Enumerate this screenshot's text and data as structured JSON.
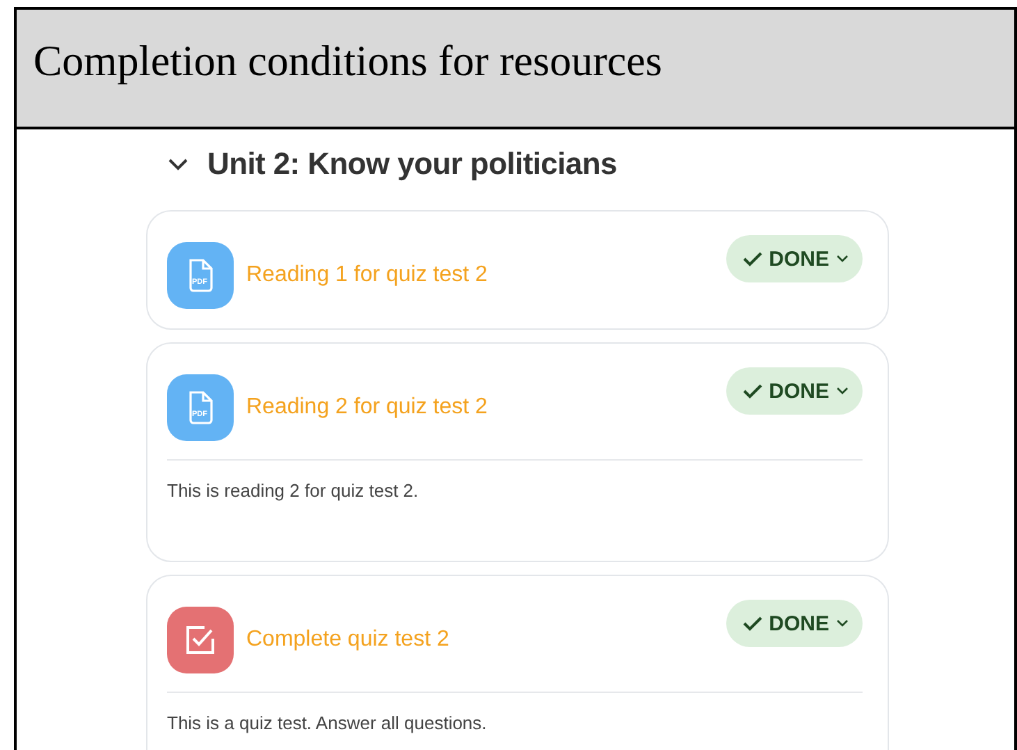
{
  "header": {
    "title": "Completion conditions for resources"
  },
  "section": {
    "title": "Unit 2: Know your politicians",
    "expanded": true,
    "activities": [
      {
        "kind": "pdf",
        "icon_label": "PDF",
        "title": "Reading 1 for quiz test 2",
        "status": "DONE",
        "done": true
      },
      {
        "kind": "pdf",
        "icon_label": "PDF",
        "title": "Reading 2 for quiz test 2",
        "status": "DONE",
        "done": true,
        "description": "This is reading 2 for quiz test 2."
      },
      {
        "kind": "quiz",
        "title": "Complete quiz test 2",
        "status": "DONE",
        "done": true,
        "description": "This is a quiz test. Answer all questions."
      }
    ]
  }
}
